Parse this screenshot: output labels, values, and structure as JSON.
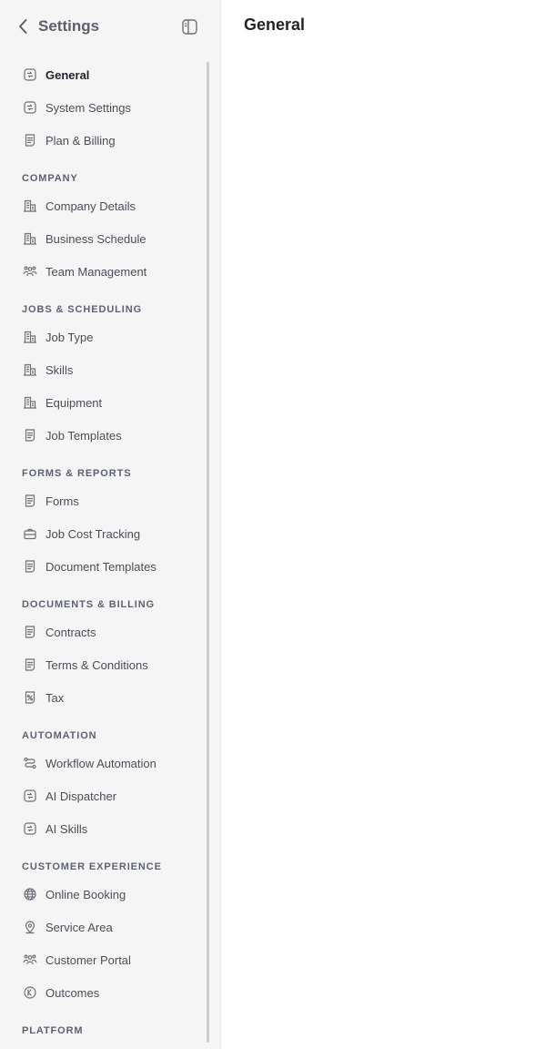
{
  "sidebar": {
    "title": "Settings",
    "sections": [
      {
        "header": "",
        "items": [
          {
            "label": "General",
            "icon": "chat-square-icon",
            "active": true
          },
          {
            "label": "System Settings",
            "icon": "chat-square-icon"
          },
          {
            "label": "Plan & Billing",
            "icon": "document-icon"
          }
        ]
      },
      {
        "header": "COMPANY",
        "items": [
          {
            "label": "Company Details",
            "icon": "building-icon"
          },
          {
            "label": "Business Schedule",
            "icon": "building-icon"
          },
          {
            "label": "Team Management",
            "icon": "team-icon"
          }
        ]
      },
      {
        "header": "JOBS & SCHEDULING",
        "items": [
          {
            "label": "Job Type",
            "icon": "building-icon"
          },
          {
            "label": "Skills",
            "icon": "building-icon"
          },
          {
            "label": "Equipment",
            "icon": "building-icon"
          },
          {
            "label": "Job Templates",
            "icon": "document-icon"
          }
        ]
      },
      {
        "header": "FORMS & REPORTS",
        "items": [
          {
            "label": "Forms",
            "icon": "document-icon"
          },
          {
            "label": "Job Cost Tracking",
            "icon": "briefcase-icon"
          },
          {
            "label": "Document Templates",
            "icon": "document-icon"
          }
        ]
      },
      {
        "header": "DOCUMENTS & BILLING",
        "items": [
          {
            "label": "Contracts",
            "icon": "document-icon"
          },
          {
            "label": "Terms & Conditions",
            "icon": "document-icon"
          },
          {
            "label": "Tax",
            "icon": "tax-document-icon"
          }
        ]
      },
      {
        "header": "AUTOMATION",
        "items": [
          {
            "label": "Workflow Automation",
            "icon": "workflow-icon"
          },
          {
            "label": "AI Dispatcher",
            "icon": "chat-square-icon"
          },
          {
            "label": "AI Skills",
            "icon": "chat-square-icon"
          }
        ]
      },
      {
        "header": "CUSTOMER EXPERIENCE",
        "items": [
          {
            "label": "Online Booking",
            "icon": "globe-icon"
          },
          {
            "label": "Service Area",
            "icon": "location-pin-icon"
          },
          {
            "label": "Customer Portal",
            "icon": "team-icon"
          },
          {
            "label": "Outcomes",
            "icon": "outcome-icon"
          }
        ]
      },
      {
        "header": "PLATFORM",
        "items": []
      }
    ]
  },
  "main": {
    "title": "General"
  },
  "colors": {
    "sidebar_bg": "#f5f5f6",
    "text": "#4a4f58",
    "icon": "#6b7079"
  }
}
